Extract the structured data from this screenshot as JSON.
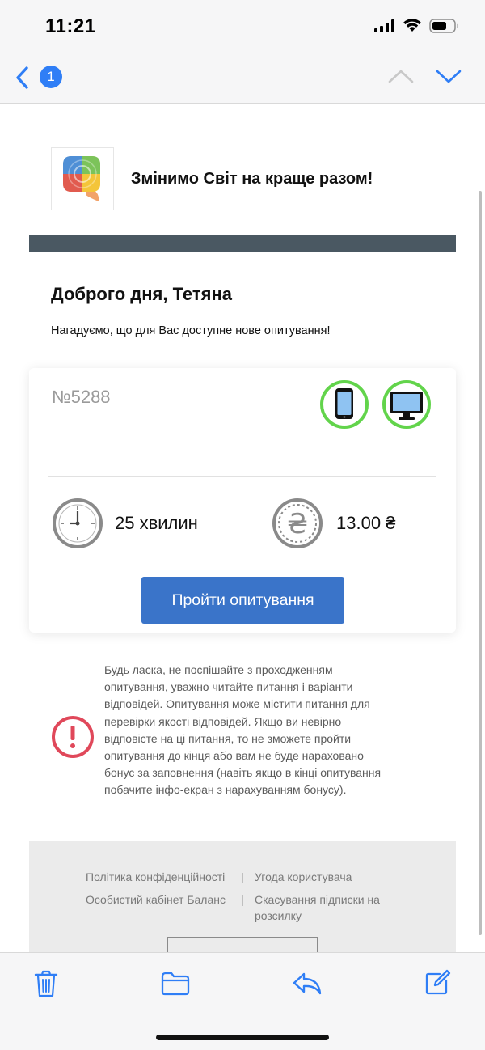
{
  "status_bar": {
    "time": "11:21"
  },
  "nav": {
    "unread_count": "1"
  },
  "email": {
    "headline": "Змінимо Світ на краще разом!",
    "greeting": "Доброго дня, Тетяна",
    "intro": "Нагадуємо, що для Вас доступне нове опитування!",
    "survey": {
      "number": "№5288",
      "devices": [
        "mobile-phone-icon",
        "desktop-monitor-icon"
      ],
      "duration": "25 хвилин",
      "reward": "13.00 ₴",
      "button_label": "Пройти опитування"
    },
    "warning": "Будь ласка, не поспішайте з проходженням опитування, уважно читайте питання і варіанти відповідей. Опитування може містити питання для перевірки якості відповідей. Якщо ви невірно відповісте на ці питання, то не зможете пройти опитування до кінця або вам не буде нараховано бонус за заповнення (навіть якщо в кінці опитування побачите інфо-екран з нарахуванням бонусу).",
    "footer": {
      "links": [
        "Політика конфіденційності",
        "Угода користувача",
        "Особистий кабінет Баланс",
        "Скасування підписки на розсилку"
      ],
      "separator": "|"
    }
  },
  "colors": {
    "accent": "#3a74c9",
    "badge": "#2f7ef6",
    "device_ring": "#62d44b",
    "warning": "#e0485a",
    "band": "#4a5862"
  }
}
